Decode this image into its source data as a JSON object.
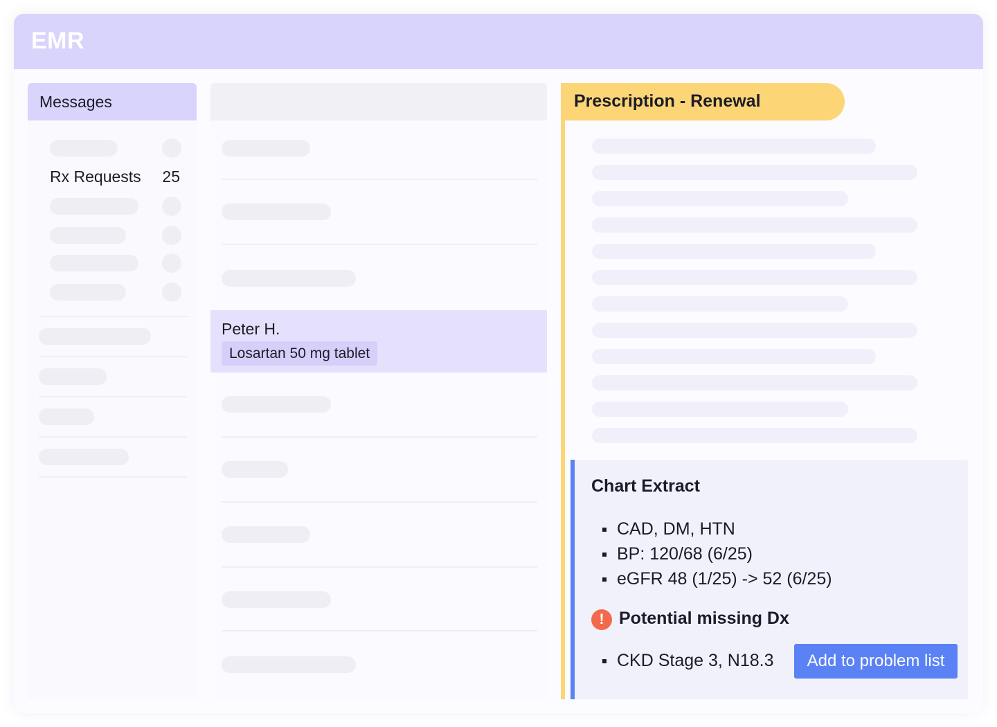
{
  "app": {
    "title": "EMR"
  },
  "sidebar": {
    "title": "Messages",
    "rx_requests": {
      "label": "Rx Requests",
      "count": "25"
    }
  },
  "list": {
    "selected": {
      "patient": "Peter H.",
      "medication": "Losartan 50 mg tablet"
    }
  },
  "detail": {
    "title": "Prescription - Renewal",
    "chart_extract": {
      "title": "Chart Extract",
      "items": [
        "CAD, DM, HTN",
        "BP: 120/68 (6/25)",
        "eGFR 48 (1/25) -> 52 (6/25)"
      ]
    },
    "missing_dx": {
      "icon": "exclamation-icon",
      "icon_glyph": "!",
      "title": "Potential missing Dx",
      "items": [
        "CKD Stage 3, N18.3"
      ],
      "action_label": "Add to problem list"
    }
  },
  "colors": {
    "header_lavender": "#d9d4fc",
    "selected_row": "#e5e1fc",
    "medication_chip": "#d5cffa",
    "prescription_accent": "#fcd676",
    "chart_extract_accent": "#5b82f5",
    "warning_icon": "#f26a4b",
    "primary_button": "#5b82f5"
  }
}
